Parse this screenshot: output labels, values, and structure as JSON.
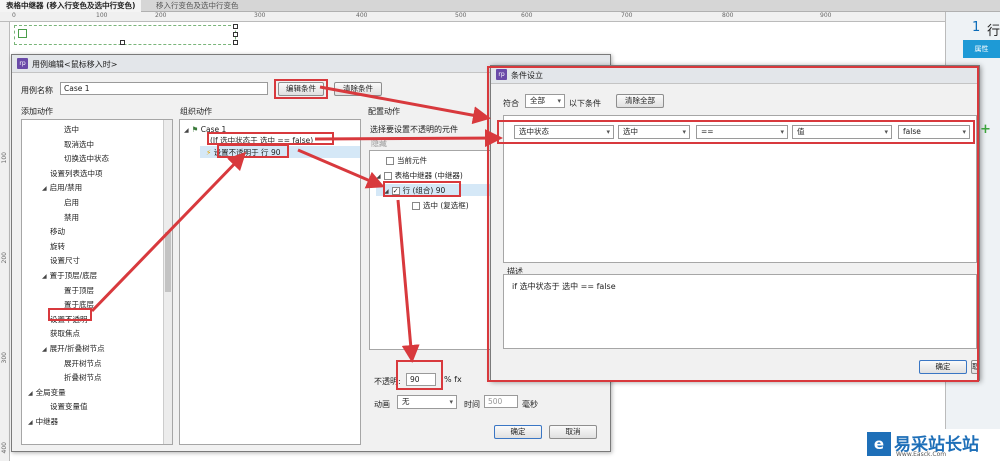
{
  "tabs": [
    {
      "label": "表格中继器 (移入行变色及选中行变色)"
    },
    {
      "label": "移入行变色及选中行变色"
    }
  ],
  "ruler": {
    "h": [
      "0",
      "100",
      "200",
      "300",
      "400",
      "500",
      "600",
      "700",
      "800",
      "900"
    ],
    "v": [
      "100",
      "200",
      "300",
      "400"
    ]
  },
  "right_panel": {
    "num": "1",
    "label": "行",
    "tab": "属性"
  },
  "case_dialog": {
    "title": "用例编辑<鼠标移入时>",
    "case_name_label": "用例名称",
    "case_name_value": "Case 1",
    "edit_condition_btn": "编辑条件",
    "clear_condition_btn": "清除条件",
    "add_action_header": "添加动作",
    "org_action_header": "组织动作",
    "config_action_header": "配置动作",
    "actions": [
      {
        "label": "选中",
        "indent": 2
      },
      {
        "label": "取消选中",
        "indent": 2
      },
      {
        "label": "切换选中状态",
        "indent": 2
      },
      {
        "label": "设置列表选中项",
        "indent": 1
      },
      {
        "label": "启用/禁用",
        "indent": 1,
        "group": true
      },
      {
        "label": "启用",
        "indent": 2
      },
      {
        "label": "禁用",
        "indent": 2
      },
      {
        "label": "移动",
        "indent": 1
      },
      {
        "label": "旋转",
        "indent": 1
      },
      {
        "label": "设置尺寸",
        "indent": 1
      },
      {
        "label": "置于顶层/底层",
        "indent": 1,
        "group": true
      },
      {
        "label": "置于顶层",
        "indent": 2
      },
      {
        "label": "置于底层",
        "indent": 2
      },
      {
        "label": "设置不透明",
        "indent": 1
      },
      {
        "label": "获取焦点",
        "indent": 1
      },
      {
        "label": "展开/折叠树节点",
        "indent": 1,
        "group": true
      },
      {
        "label": "展开树节点",
        "indent": 2
      },
      {
        "label": "折叠树节点",
        "indent": 2
      },
      {
        "label": "全局变量",
        "indent": 0,
        "group": true
      },
      {
        "label": "设置变量值",
        "indent": 1
      },
      {
        "label": "中继器",
        "indent": 0,
        "group": true
      }
    ],
    "org": {
      "case": "Case 1",
      "condition": "(If 选中状态于 选中 == false)",
      "action": "设置不透明于 行 90"
    },
    "config": {
      "select_label": "选择要设置不透明的元件",
      "hide": "隐藏",
      "items": [
        {
          "label": "当前元件",
          "checked": false,
          "indent": 1
        },
        {
          "label": "表格中继器 (中继器)",
          "checked": false,
          "indent": 1
        },
        {
          "label": "行 (组合) 90",
          "checked": true,
          "indent": 2
        },
        {
          "label": "选中 (复选框)",
          "checked": false,
          "indent": 3
        }
      ],
      "opacity_label": "不透明:",
      "opacity_value": "90",
      "opacity_unit": "% fx",
      "anim_label": "动画",
      "anim_value": "无",
      "time_label": "时间",
      "time_value": "500",
      "time_unit": "毫秒"
    },
    "ok": "确定",
    "cancel": "取消"
  },
  "condition_dialog": {
    "title": "条件设立",
    "match_label": "符合",
    "match_value": "全部",
    "match_suffix": "以下条件",
    "clear_all": "清除全部",
    "row": [
      "选中状态",
      "选中",
      "==",
      "值",
      "false"
    ],
    "desc_label": "描述",
    "desc_text": "if 选中状态于 选中 == false",
    "ok": "确定",
    "cancel": "取"
  },
  "watermark": {
    "text": "易采站长站",
    "sub": "Www.Easck.Com"
  },
  "colors": {
    "accent_red": "#d8393d",
    "brand_blue": "#1e9ad6"
  }
}
